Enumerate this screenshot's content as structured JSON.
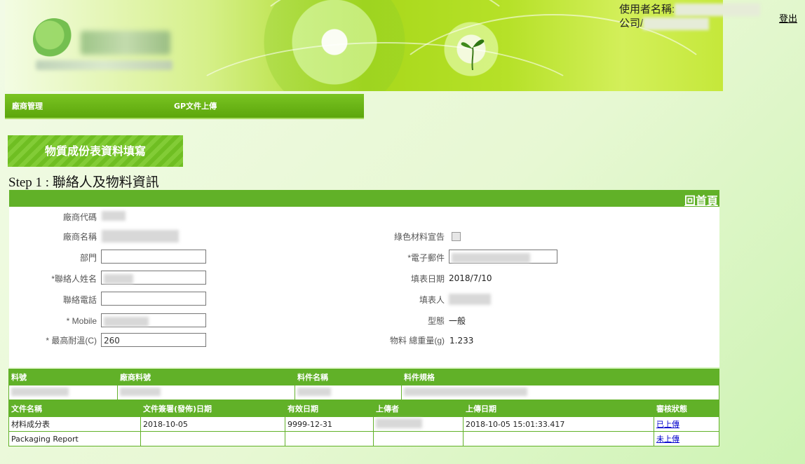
{
  "header": {
    "user_label": "使用者名稱:",
    "company_label": "公司/",
    "logout": "登出"
  },
  "menu": {
    "items": [
      "廠商管理",
      "GP文件上傳"
    ]
  },
  "section_button": "物質成份表資料填寫",
  "step_title": "Step 1 : 聯絡人及物料資訊",
  "home_link": "回首頁",
  "form": {
    "vendor_code_label": "廠商代碼",
    "vendor_name_label": "廠商名稱",
    "dept_label": "部門",
    "contact_name_label": "*聯絡人姓名",
    "phone_label": "聯絡電話",
    "mobile_label": "* Mobile",
    "max_temp_label": "* 最高耐溫(C)",
    "max_temp_value": "260",
    "green_label": "綠色材料宣告",
    "email_label": "*電子郵件",
    "fill_date_label": "填表日期",
    "fill_date_value": "2018/7/10",
    "filler_label": "填表人",
    "type_label": "型態",
    "type_value": "一般",
    "weight_label": "物料 總重量(g)",
    "weight_value": "1.233"
  },
  "material_table": {
    "headers": [
      "料號",
      "廠商料號",
      "料件名稱",
      "料件規格"
    ]
  },
  "doc_table": {
    "headers": [
      "文件名稱",
      "文件簽署(發佈)日期",
      "有效日期",
      "上傳者",
      "上傳日期",
      "審核狀態"
    ],
    "rows": [
      {
        "name": "材料成分表",
        "sign_date": "2018-10-05",
        "valid_date": "9999-12-31",
        "upload_date": "2018-10-05 15:01:33.417",
        "status": "已上傳"
      },
      {
        "name": "Packaging Report",
        "sign_date": "",
        "valid_date": "",
        "upload_date": "",
        "status": "未上傳"
      }
    ]
  },
  "colors": {
    "accent_green": "#61b128",
    "link_blue": "#0000cc"
  }
}
